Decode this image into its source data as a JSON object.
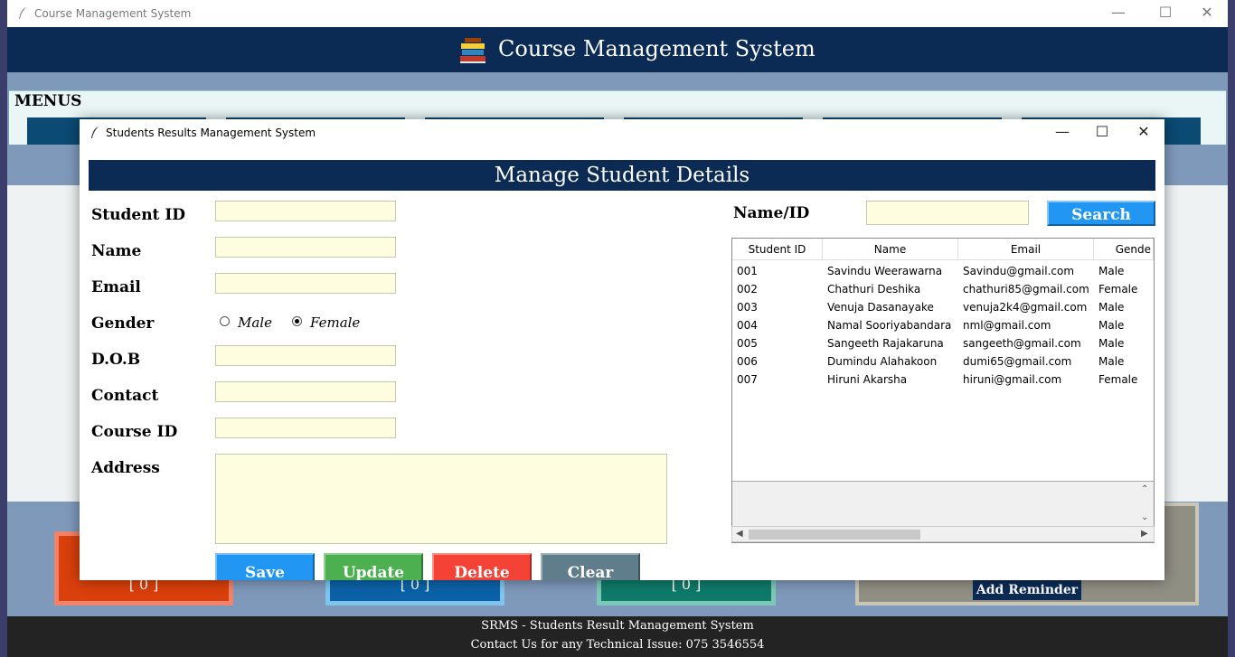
{
  "main_window": {
    "title": "Course Management System",
    "header_title": "Course Management System",
    "menus_label": "MENUS",
    "stats": [
      {
        "value": "[ 0 ]",
        "color": "#d9400b",
        "border": "#f0836b"
      },
      {
        "value": "[ 0 ]",
        "color": "#0b62a8",
        "border": "#7fc4ec"
      },
      {
        "value": "[ 0 ]",
        "color": "#0f7a6a",
        "border": "#7cc8b8"
      }
    ],
    "reminder_button": "Add Reminder",
    "footer": {
      "line1": "SRMS - Students Result Management System",
      "line2": "Contact Us for any Technical Issue: 075 3546554"
    }
  },
  "child_window": {
    "title": "Students Results Management System",
    "header_title": "Manage Student Details",
    "form": {
      "student_id_label": "Student ID",
      "name_label": "Name",
      "email_label": "Email",
      "gender_label": "Gender",
      "gender_options": [
        "Male",
        "Female"
      ],
      "gender_selected": "Female",
      "dob_label": "D.O.B",
      "contact_label": "Contact",
      "course_id_label": "Course ID",
      "address_label": "Address"
    },
    "buttons": {
      "save": "Save",
      "update": "Update",
      "delete": "Delete",
      "clear": "Clear"
    },
    "button_colors": {
      "save": "#2196f3",
      "update": "#4caf50",
      "delete": "#f44336",
      "clear": "#607d8b"
    },
    "search": {
      "label": "Name/ID",
      "button": "Search"
    },
    "table": {
      "columns": [
        "Student ID",
        "Name",
        "Email",
        "Gende"
      ],
      "rows": [
        [
          "001",
          "Savindu Weerawarna",
          "Savindu@gmail.com",
          "Male"
        ],
        [
          "002",
          "Chathuri Deshika",
          "chathuri85@gmail.com",
          "Female"
        ],
        [
          "003",
          "Venuja Dasanayake",
          "venuja2k4@gmail.com",
          "Male"
        ],
        [
          "004",
          "Namal Sooriyabandara",
          "nml@gmail.com",
          "Male"
        ],
        [
          "005",
          "Sangeeth Rajakaruna",
          "sangeeth@gmail.com",
          "Male"
        ],
        [
          "006",
          "Dumindu Alahakoon",
          "dumi65@gmail.com",
          "Male"
        ],
        [
          "007",
          "Hiruni Akarsha",
          "hiruni@gmail.com",
          "Female"
        ]
      ]
    }
  }
}
